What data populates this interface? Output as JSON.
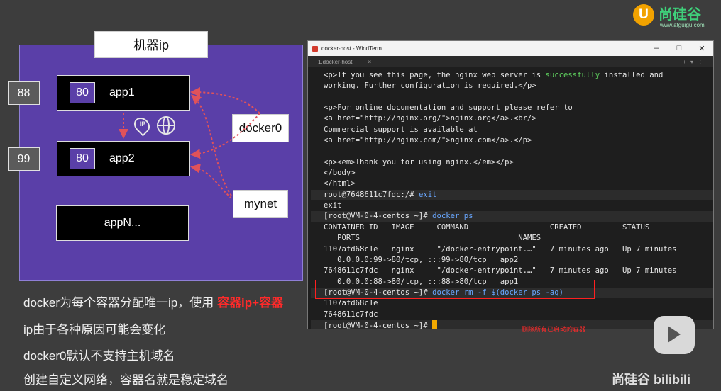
{
  "diagram": {
    "machine_title": "机器ip",
    "apps": [
      {
        "port": "80",
        "name": "app1",
        "host_port": "88"
      },
      {
        "port": "80",
        "name": "app2",
        "host_port": "99"
      }
    ],
    "app_n": "appN...",
    "networks": [
      "docker0",
      "mynet"
    ],
    "ip_badge": "IP"
  },
  "bullets": [
    {
      "text": "docker为每个容器分配唯一ip，使用 ",
      "highlight": "容器ip+容器"
    },
    {
      "text": "ip由于各种原因可能会变化"
    },
    {
      "text": "docker0默认不支持主机域名"
    },
    {
      "text": "创建自定义网络，容器名就是稳定域名"
    }
  ],
  "terminal": {
    "window_title": "docker-host - WindTerm",
    "tab_label": "1.docker-host",
    "tab_close": "×",
    "annotation": "删除所有已启动的容器"
  },
  "branding": {
    "logo_letter": "U",
    "logo_text": "尚硅谷",
    "logo_url": "www.atguigu.com",
    "watermark": "尚硅谷 bilibili"
  },
  "colors": {
    "machine_bg": "#5a3fa8",
    "highlight": "#ff2a2a",
    "terminal_bg": "#1e1e1e",
    "success_green": "#5fd25f",
    "command_blue": "#69a7ff",
    "cursor": "#f2a900"
  }
}
